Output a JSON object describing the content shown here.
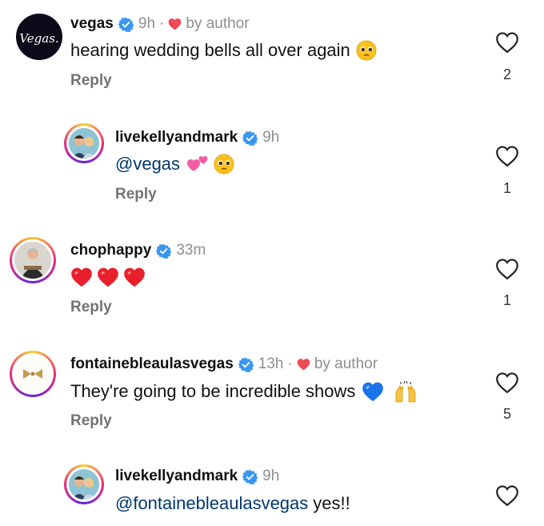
{
  "comments": [
    {
      "username": "vegas",
      "time": "9h",
      "by_author": "by author",
      "text": "hearing wedding bells all over again",
      "reply": "Reply",
      "likes": "2",
      "avatar_logo": "Vegas."
    },
    {
      "username": "livekellyandmark",
      "time": "9h",
      "mention": "@vegas",
      "reply": "Reply",
      "likes": "1"
    },
    {
      "username": "chophappy",
      "time": "33m",
      "reply": "Reply",
      "likes": "1"
    },
    {
      "username": "fontainebleaulasvegas",
      "time": "13h",
      "by_author": "by author",
      "text": "They're going to be incredible shows",
      "reply": "Reply",
      "likes": "5"
    },
    {
      "username": "livekellyandmark",
      "time": "9h",
      "mention": "@fontainebleaulasvegas",
      "text": "yes!!"
    }
  ],
  "icons": {
    "verified": "verified-badge-icon",
    "heart": "heart-outline-icon",
    "author_heart": "red-heart-icon"
  },
  "colors": {
    "verified_blue": "#3897f0",
    "author_heart_red": "#ed4956",
    "secondary_text": "#8e8e8e",
    "mention_blue": "#00376b"
  }
}
